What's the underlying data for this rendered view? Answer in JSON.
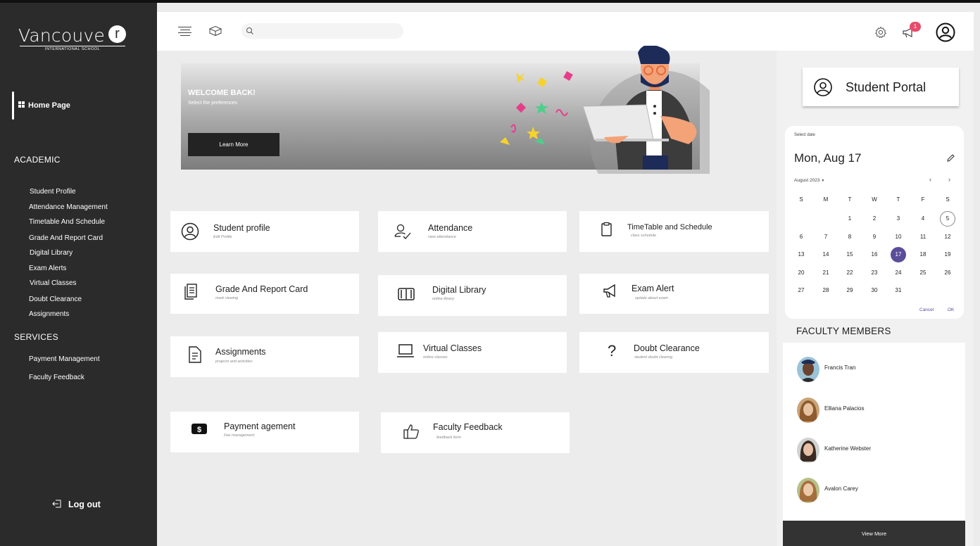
{
  "sidebar": {
    "logo_text": "Vancouve",
    "logo_letter": "r",
    "logo_sub": "INTERNATIONAL SCHOOL",
    "home": "Home Page",
    "academic_heading": "ACADEMIC",
    "academic_items": [
      "Student Profile",
      "Attendance Management",
      "Timetable And Schedule",
      "Grade And Report Card",
      "Digital Library",
      "Exam Alerts",
      "Virtual Classes",
      "Doubt Clearance",
      "Assignments"
    ],
    "services_heading": "SERVICES",
    "services_items": [
      "Payment Management",
      "Faculty Feedback"
    ],
    "logout": "Log out"
  },
  "header": {
    "search_placeholder": "",
    "notification_count": "1"
  },
  "banner": {
    "title": "WELCOME BACK!",
    "subtitle": "Select the preferences",
    "button": "Learn More"
  },
  "cards": [
    {
      "title": "Student profile",
      "sub": "Edit Profile",
      "icon": "user-circle-icon"
    },
    {
      "title": "Attendance",
      "sub": "view attendance",
      "icon": "user-check-icon"
    },
    {
      "title": "TimeTable and Schedule",
      "sub": "class schedule",
      "icon": "clipboard-icon"
    },
    {
      "title": "Grade And Report Card",
      "sub": "mark viewing",
      "icon": "report-card-icon"
    },
    {
      "title": "Digital Library",
      "sub": "online library",
      "icon": "book-icon"
    },
    {
      "title": "Exam Alert",
      "sub": "update about exam",
      "icon": "megaphone-icon"
    },
    {
      "title": "Assignments",
      "sub": "projects and activities",
      "icon": "document-icon"
    },
    {
      "title": "Virtual Classes",
      "sub": "online classes",
      "icon": "laptop-icon"
    },
    {
      "title": "Doubt Clearance",
      "sub": "student doubt clearing",
      "icon": "question-icon"
    },
    {
      "title": "Payment agement",
      "sub": "Fee management",
      "icon": "dollar-icon"
    },
    {
      "title": "Faculty Feedback",
      "sub": "feedback form",
      "icon": "thumbs-up-icon"
    }
  ],
  "portal": {
    "title": "Student Portal"
  },
  "calendar": {
    "select_label": "Select date",
    "selected_date": "Mon, Aug 17",
    "month_label": "August 2023",
    "weekdays": [
      "S",
      "M",
      "T",
      "W",
      "T",
      "F",
      "S"
    ],
    "weeks": [
      [
        "",
        "",
        "1",
        "2",
        "3",
        "4",
        "5"
      ],
      [
        "6",
        "7",
        "8",
        "9",
        "10",
        "11",
        "12"
      ],
      [
        "13",
        "14",
        "15",
        "16",
        "17",
        "18",
        "19"
      ],
      [
        "20",
        "21",
        "22",
        "23",
        "24",
        "25",
        "26"
      ],
      [
        "27",
        "28",
        "29",
        "30",
        "31",
        "",
        ""
      ]
    ],
    "selected_day": "17",
    "outlined_day": "5",
    "cancel": "Cancel",
    "ok": "OK",
    "accent": "#5b4d99"
  },
  "faculty": {
    "title": "FACULTY MEMBERS",
    "members": [
      "Francis Tran",
      "Elliana Palacios",
      "Katherine Webster",
      "Avalon Carey"
    ],
    "view_more": "View More"
  }
}
